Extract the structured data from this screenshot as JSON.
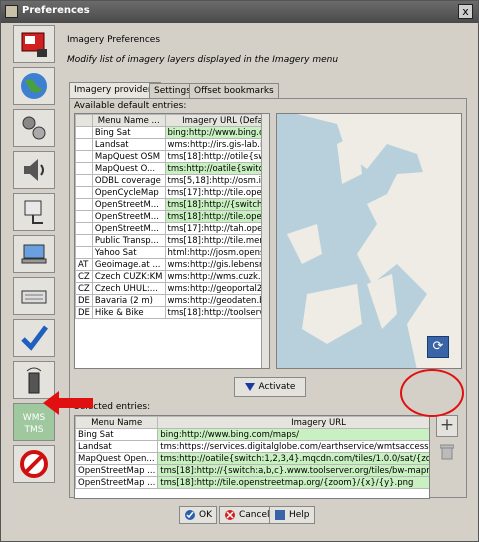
{
  "window": {
    "title": "Preferences",
    "close_glyph": "x"
  },
  "iconbar": {
    "items": [
      {
        "icon": "display-preferences-icon"
      },
      {
        "icon": "globe-icon"
      },
      {
        "icon": "plugin-icon"
      },
      {
        "icon": "speaker-icon"
      },
      {
        "icon": "connection-icon"
      },
      {
        "icon": "laptop-icon"
      },
      {
        "icon": "keyboard-icon"
      },
      {
        "icon": "checkmark-icon"
      },
      {
        "icon": "remote-control-icon"
      },
      {
        "icon": "wms-tms-icon",
        "text": "WMS TMS",
        "selected": true
      },
      {
        "icon": "no-entry-sign-icon"
      }
    ]
  },
  "header": {
    "title": "Imagery Preferences",
    "subtitle": "Modify list of imagery layers displayed in the Imagery menu"
  },
  "tabs": [
    {
      "label": "Imagery providers",
      "active": true
    },
    {
      "label": "Settings",
      "active": false
    },
    {
      "label": "Offset bookmarks",
      "active": false
    }
  ],
  "defaults": {
    "label": "Available default entries:",
    "columns": [
      "",
      "Menu Name ...",
      "Imagery URL (Default)"
    ],
    "rows": [
      {
        "cc": "",
        "name": "Bing Sat",
        "url": "bing:http://www.bing.com/...",
        "green": true
      },
      {
        "cc": "",
        "name": "Landsat",
        "url": "wms:http://irs.gis-lab.info/...",
        "green": false
      },
      {
        "cc": "",
        "name": "MapQuest OSM",
        "url": "tms[18]:http://otile{switch:...",
        "green": false
      },
      {
        "cc": "",
        "name": "MapQuest O...",
        "url": "tms:http://oatile{switch:1...",
        "green": true
      },
      {
        "cc": "",
        "name": "ODBL coverage",
        "url": "tms[5,18]:http://osm.infor...",
        "green": false
      },
      {
        "cc": "",
        "name": "OpenCycleMap",
        "url": "tms[17]:http://tile.opencyc...",
        "green": false
      },
      {
        "cc": "",
        "name": "OpenStreetM...",
        "url": "tms[18]:http://{switch:a,b...",
        "green": true
      },
      {
        "cc": "",
        "name": "OpenStreetM...",
        "url": "tms[18]:http://tile.openstr...",
        "green": true
      },
      {
        "cc": "",
        "name": "OpenStreetM...",
        "url": "tms[17]:http://tah.openstr...",
        "green": false
      },
      {
        "cc": "",
        "name": "Public Transp...",
        "url": "tms[18]:http://tile.memom...",
        "green": false
      },
      {
        "cc": "",
        "name": "Yahoo Sat",
        "url": "html:http://josm.openstree...",
        "green": false
      },
      {
        "cc": "AT",
        "name": "Geoimage.at ...",
        "url": "wms:http://gis.lebensminis...",
        "green": false
      },
      {
        "cc": "CZ",
        "name": "Czech CUZK:KM",
        "url": "wms:http://wms.cuzk.cz/w...",
        "green": false
      },
      {
        "cc": "CZ",
        "name": "Czech UHUL:...",
        "url": "wms:http://geoportal2.uhu...",
        "green": false
      },
      {
        "cc": "DE",
        "name": "Bavaria (2 m)",
        "url": "wms:http://geodaten.baye...",
        "green": false
      },
      {
        "cc": "DE",
        "name": "Hike & Bike",
        "url": "tms[18]:http://toolserver....",
        "green": false
      }
    ]
  },
  "activate_label": "Activate",
  "selected": {
    "label": "Selected entries:",
    "columns": [
      "Menu Name",
      "Imagery URL"
    ],
    "rows": [
      {
        "name": "Bing Sat",
        "url": "bing:http://www.bing.com/maps/",
        "green": true
      },
      {
        "name": "Landsat",
        "url": "tms:https://services.digitalglobe.com/earthservice/wmtsaccess?CONN...",
        "green": false
      },
      {
        "name": "MapQuest Open...",
        "url": "tms:http://oatile{switch:1,2,3,4}.mqcdn.com/tiles/1.0.0/sat/{zoom}/{x}...",
        "green": true
      },
      {
        "name": "OpenStreetMap ...",
        "url": "tms[18]:http://{switch:a,b,c}.www.toolserver.org/tiles/bw-mapnik/{z...",
        "green": true
      },
      {
        "name": "OpenStreetMap ...",
        "url": "tms[18]:http://tile.openstreetmap.org/{zoom}/{x}/{y}.png",
        "green": true
      }
    ]
  },
  "footer": {
    "ok": "OK",
    "cancel": "Cancel",
    "help": "Help"
  },
  "annotation_color": "#e01010"
}
